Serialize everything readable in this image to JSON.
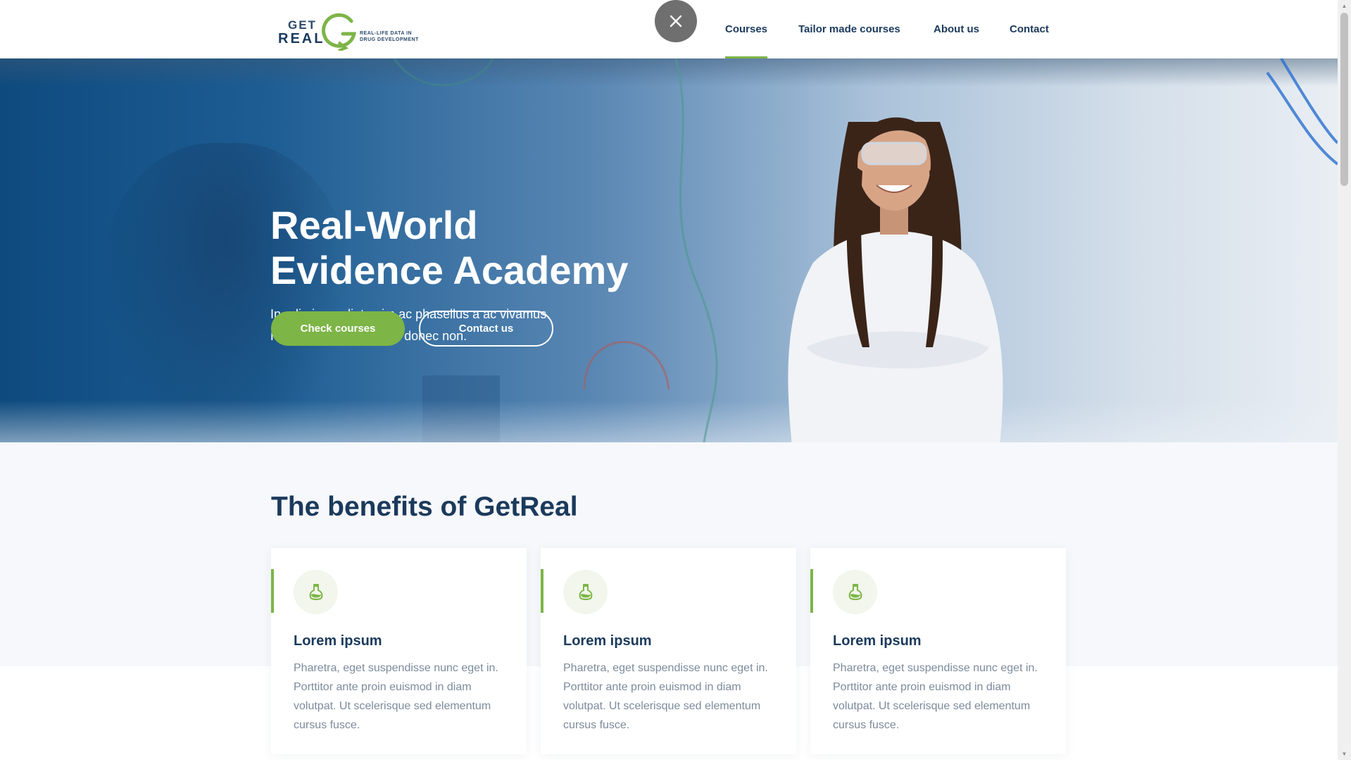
{
  "header": {
    "logo": {
      "line1": "GET",
      "line2": "REAL",
      "tagline_line1": "REAL-LIFE DATA IN",
      "tagline_line2": "DRUG DEVELOPMENT"
    },
    "close_icon": "close-icon",
    "nav": [
      {
        "label": "Courses",
        "active": true
      },
      {
        "label": "Tailor made courses",
        "active": false
      },
      {
        "label": "About us",
        "active": false
      },
      {
        "label": "Contact",
        "active": false
      }
    ]
  },
  "hero": {
    "title_line1": "Real-World",
    "title_line2": "Evidence Academy",
    "subtitle_line1": "In odio imperdiet enim ac phasellus a ac vivamus.",
    "subtitle_line2": "Hendrerit id eleifend ac donec non.",
    "primary_button": "Check courses",
    "secondary_button": "Contact us"
  },
  "benefits": {
    "heading": "The benefits of GetReal",
    "cards": [
      {
        "icon": "flask-icon",
        "title": "Lorem ipsum",
        "text": "Pharetra, eget suspendisse nunc eget in. Porttitor ante proin euismod in diam volutpat. Ut scelerisque sed elementum cursus fusce."
      },
      {
        "icon": "flask-icon",
        "title": "Lorem ipsum",
        "text": "Pharetra, eget suspendisse nunc eget in. Porttitor ante proin euismod in diam volutpat. Ut scelerisque sed elementum cursus fusce."
      },
      {
        "icon": "flask-icon",
        "title": "Lorem ipsum",
        "text": "Pharetra, eget suspendisse nunc eget in. Porttitor ante proin euismod in diam volutpat. Ut scelerisque sed elementum cursus fusce."
      }
    ]
  },
  "colors": {
    "brand_navy": "#1b3a5c",
    "brand_green": "#7db547",
    "hero_blue": "#0e4a7e"
  }
}
